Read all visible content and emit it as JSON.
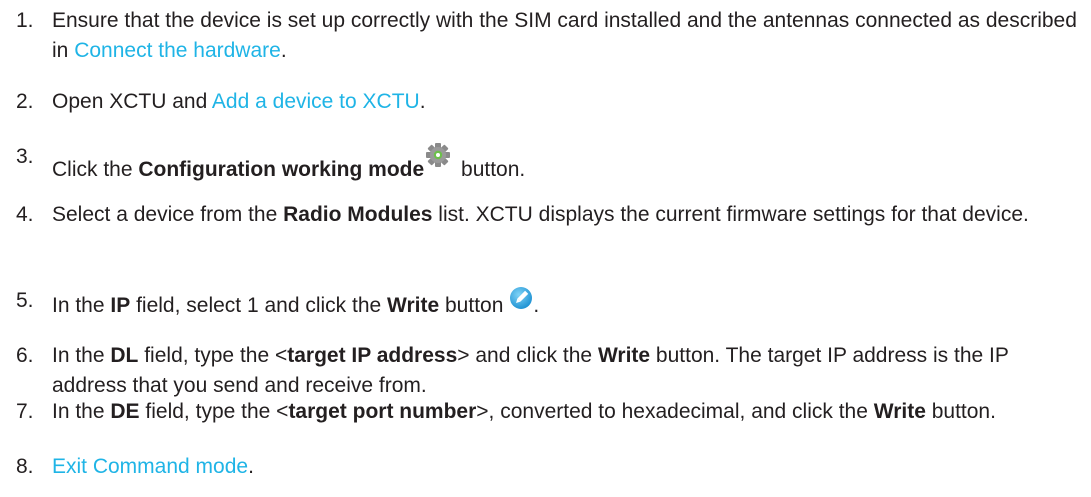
{
  "steps": [
    {
      "num": "1.",
      "pre": "Ensure that the device is set up correctly with the SIM card installed and the antennas connected as described in ",
      "link": "Connect the hardware",
      "post": "."
    },
    {
      "num": "2.",
      "pre": "Open XCTU and ",
      "link": "Add a device to XCTU",
      "post": "."
    },
    {
      "num": "3.",
      "pre": "Click the ",
      "bold": "Configuration working mode",
      "icon": "configuration-gear-icon",
      "post": " button."
    },
    {
      "num": "4.",
      "pre": "Select a device from the ",
      "bold": "Radio Modules",
      "post": " list. XCTU displays the current firmware settings for that device."
    },
    {
      "num": "5.",
      "pre": "In the ",
      "bold1": "IP",
      "mid": " field, select 1 and click the ",
      "bold2": "Write",
      "post": " button",
      "icon": "write-pencil-icon",
      "end": "."
    },
    {
      "num": "6.",
      "pre": "In the ",
      "bold1": "DL",
      "mid1": " field, type the <",
      "bold2": "target IP address",
      "mid2": "> and click the ",
      "bold3": "Write",
      "post": " button. The target IP address is the IP address that you send and receive from."
    },
    {
      "num": "7.",
      "pre": "In the ",
      "bold1": "DE",
      "mid1": " field, type the <",
      "bold2": "target port number",
      "mid2": ">, converted to hexadecimal, and click the ",
      "bold3": "Write",
      "post": " button."
    },
    {
      "num": "8.",
      "link": "Exit Command mode",
      "post": "."
    }
  ],
  "colors": {
    "link": "#1fb4e6",
    "text": "#231f20"
  }
}
